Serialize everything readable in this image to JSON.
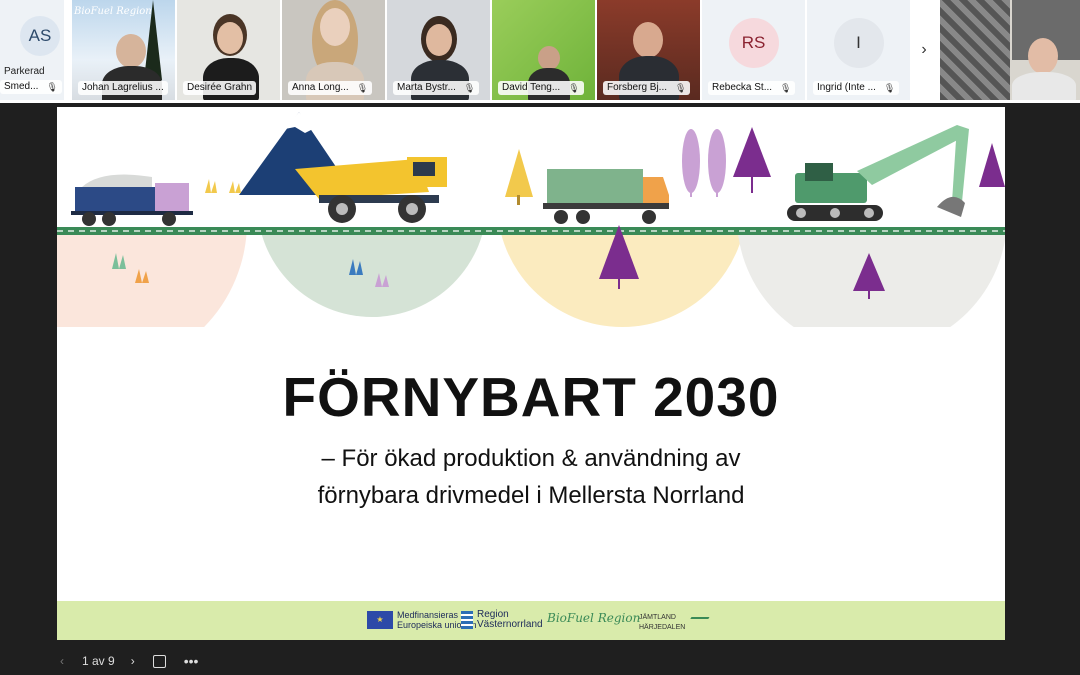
{
  "participants": [
    {
      "initials": "AS",
      "status": "Parkerad",
      "name": "Smed..."
    },
    {
      "name": "Johan Lagrelius ..."
    },
    {
      "name": "Desirée Grahn"
    },
    {
      "name": "Anna Long..."
    },
    {
      "name": "Marta Bystr..."
    },
    {
      "name": "David Teng..."
    },
    {
      "name": "Forsberg Bj..."
    },
    {
      "initials": "RS",
      "name": "Rebecka St..."
    },
    {
      "initials": "I",
      "name": "Ingrid (Inte ..."
    }
  ],
  "tile_logo": "BioFuel Region",
  "more_icon": "chevron-right-icon",
  "slide": {
    "title": "FÖRNYBART 2030",
    "subtitle_line1": "– För ökad produktion & användning av",
    "subtitle_line2": "förnybara drivmedel i Mellersta Norrland",
    "logos": {
      "eu_line1": "Medfinansieras av",
      "eu_line2": "Europeiska unionen",
      "region_line1": "Region",
      "region_line2": "Västernorrland",
      "biofuel": "BioFuel Region",
      "jamtland_line1": "JÄMTLAND",
      "jamtland_line2": "HÄRJEDALEN"
    }
  },
  "controls": {
    "page_indicator": "1 av 9"
  },
  "colors": {
    "footer": "#d9ebab",
    "accent_purple": "#7b2d8e",
    "tree_yellow": "#f2c94c",
    "truck_blue": "#2c4a86",
    "dumper_yellow": "#f3c42e",
    "excavator_green": "#4f9a6c"
  }
}
